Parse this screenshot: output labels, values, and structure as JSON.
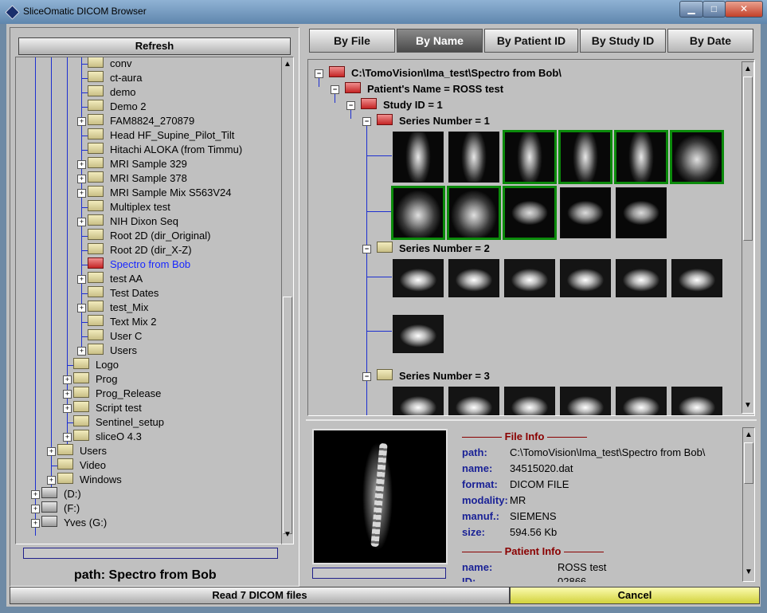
{
  "window": {
    "title": "SliceOmatic DICOM Browser",
    "minimize": "▁",
    "maximize": "□",
    "close": "✕"
  },
  "left": {
    "refresh_label": "Refresh",
    "path_label": "path:  Spectro from Bob",
    "tree": [
      {
        "label": "conv",
        "indent": 2,
        "exp": false,
        "selected": false
      },
      {
        "label": "ct-aura",
        "indent": 2,
        "exp": false,
        "selected": false
      },
      {
        "label": "demo",
        "indent": 2,
        "exp": false,
        "selected": false
      },
      {
        "label": "Demo 2",
        "indent": 2,
        "exp": false,
        "selected": false
      },
      {
        "label": "FAM8824_270879",
        "indent": 2,
        "exp": true,
        "selected": false
      },
      {
        "label": "Head HF_Supine_Pilot_Tilt",
        "indent": 2,
        "exp": false,
        "selected": false
      },
      {
        "label": "Hitachi ALOKA (from Timmu)",
        "indent": 2,
        "exp": false,
        "selected": false
      },
      {
        "label": "MRI Sample 329",
        "indent": 2,
        "exp": true,
        "selected": false
      },
      {
        "label": "MRI Sample 378",
        "indent": 2,
        "exp": true,
        "selected": false
      },
      {
        "label": "MRI Sample Mix S563V24",
        "indent": 2,
        "exp": true,
        "selected": false
      },
      {
        "label": "Multiplex test",
        "indent": 2,
        "exp": false,
        "selected": false
      },
      {
        "label": "NIH Dixon Seq",
        "indent": 2,
        "exp": true,
        "selected": false
      },
      {
        "label": "Root 2D (dir_Original)",
        "indent": 2,
        "exp": false,
        "selected": false
      },
      {
        "label": "Root 2D (dir_X-Z)",
        "indent": 2,
        "exp": false,
        "selected": false
      },
      {
        "label": "Spectro from Bob",
        "indent": 2,
        "exp": false,
        "selected": true
      },
      {
        "label": "test AA",
        "indent": 2,
        "exp": true,
        "selected": false
      },
      {
        "label": "Test Dates",
        "indent": 2,
        "exp": false,
        "selected": false
      },
      {
        "label": "test_Mix",
        "indent": 2,
        "exp": true,
        "selected": false
      },
      {
        "label": "Text Mix 2",
        "indent": 2,
        "exp": false,
        "selected": false
      },
      {
        "label": "User C",
        "indent": 2,
        "exp": false,
        "selected": false
      },
      {
        "label": "Users",
        "indent": 2,
        "exp": true,
        "selected": false
      },
      {
        "label": "Logo",
        "indent": 1,
        "exp": false,
        "selected": false
      },
      {
        "label": "Prog",
        "indent": 1,
        "exp": true,
        "selected": false
      },
      {
        "label": "Prog_Release",
        "indent": 1,
        "exp": true,
        "selected": false
      },
      {
        "label": "Script test",
        "indent": 1,
        "exp": true,
        "selected": false
      },
      {
        "label": "Sentinel_setup",
        "indent": 1,
        "exp": false,
        "selected": false
      },
      {
        "label": "sliceO 4.3",
        "indent": 1,
        "exp": true,
        "selected": false
      },
      {
        "label": "Users",
        "indent": 0,
        "exp": true,
        "selected": false
      },
      {
        "label": "Video",
        "indent": 0,
        "exp": false,
        "selected": false
      },
      {
        "label": "Windows",
        "indent": 0,
        "exp": true,
        "selected": false
      },
      {
        "label": "(D:)",
        "indent": -1,
        "exp": true,
        "selected": false,
        "drive": true
      },
      {
        "label": "(F:)",
        "indent": -1,
        "exp": true,
        "selected": false,
        "drive": true
      },
      {
        "label": "Yves (G:)",
        "indent": -1,
        "exp": true,
        "selected": false,
        "drive": true
      }
    ]
  },
  "tabs": [
    {
      "label": "By File",
      "active": false
    },
    {
      "label": "By Name",
      "active": true
    },
    {
      "label": "By Patient ID",
      "active": false
    },
    {
      "label": "By Study ID",
      "active": false
    },
    {
      "label": "By Date",
      "active": false
    }
  ],
  "series_tree": {
    "root": "C:\\TomoVision\\Ima_test\\Spectro from Bob\\",
    "patient": "Patient's Name = ROSS test",
    "study": "Study ID = 1",
    "series": [
      "Series Number = 1",
      "Series Number = 2",
      "Series Number = 3"
    ]
  },
  "info": {
    "file_info_title": "File Info",
    "patient_info_title": "Patient Info",
    "file": [
      {
        "label": "path:",
        "value": "C:\\TomoVision\\Ima_test\\Spectro from Bob\\"
      },
      {
        "label": "name:",
        "value": "34515020.dat"
      },
      {
        "label": "format:",
        "value": "DICOM FILE"
      },
      {
        "label": "modality:",
        "value": "MR"
      },
      {
        "label": "manuf.:",
        "value": "SIEMENS"
      },
      {
        "label": "size:",
        "value": "594.56 Kb"
      }
    ],
    "patient": [
      {
        "label": "name:",
        "value": "ROSS test"
      },
      {
        "label": "ID:",
        "value": "02866"
      }
    ]
  },
  "status": {
    "message": "Read 7 DICOM files",
    "cancel_label": "Cancel"
  }
}
